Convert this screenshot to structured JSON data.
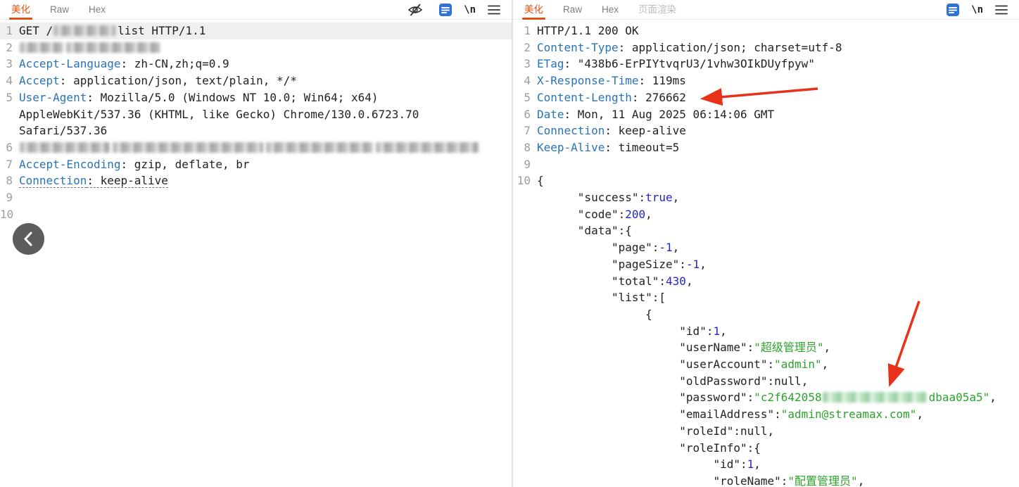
{
  "colors": {
    "accent_tab": "#e05210",
    "header_key": "#2973b7",
    "json_number": "#2525c6",
    "json_string": "#2ca32c",
    "arrow_red": "#e8311a",
    "format_icon_blue": "#2e74d8"
  },
  "left_panel": {
    "tabs": [
      {
        "label": "美化",
        "active": true
      },
      {
        "label": "Raw",
        "active": false
      },
      {
        "label": "Hex",
        "active": false
      }
    ],
    "newline_glyph": "\\n",
    "rows": [
      {
        "num": "1",
        "hl": true,
        "segs": [
          {
            "t": "GET /",
            "c": "p"
          },
          {
            "blur": 88
          },
          {
            "t": "list HTTP/1.1",
            "c": "p"
          }
        ]
      },
      {
        "num": "2",
        "segs": [
          {
            "blur": 62
          },
          {
            "blur": 134
          }
        ]
      },
      {
        "num": "3",
        "segs": [
          {
            "t": "Accept-Language",
            "c": "k"
          },
          {
            "t": ": zh-CN,zh;q=0.9",
            "c": "p"
          }
        ]
      },
      {
        "num": "4",
        "segs": [
          {
            "t": "Accept",
            "c": "k"
          },
          {
            "t": ": application/json, text/plain, */*",
            "c": "p"
          }
        ]
      },
      {
        "num": "5",
        "segs": [
          {
            "t": "User-Agent",
            "c": "k"
          },
          {
            "t": ": Mozilla/5.0 (Windows NT 10.0; Win64; x64)",
            "c": "p"
          }
        ]
      },
      {
        "num": "",
        "segs": [
          {
            "t": "AppleWebKit/537.36 (KHTML, like Gecko) Chrome/130.0.6723.70",
            "c": "p"
          }
        ]
      },
      {
        "num": "",
        "segs": [
          {
            "t": "Safari/537.36",
            "c": "p"
          }
        ]
      },
      {
        "num": "6",
        "segs": [
          {
            "blur": 128
          },
          {
            "blur": 214
          },
          {
            "blur": 152
          },
          {
            "blur": 146
          }
        ]
      },
      {
        "num": "7",
        "segs": [
          {
            "t": "Accept-Encoding",
            "c": "k"
          },
          {
            "t": ": gzip, deflate, br",
            "c": "p"
          }
        ]
      },
      {
        "num": "8",
        "segs": [
          {
            "t": "Connection",
            "c": "k u"
          },
          {
            "t": ": keep-alive",
            "c": "p u"
          }
        ]
      },
      {
        "num": "9",
        "segs": []
      },
      {
        "num": "10",
        "segs": []
      }
    ]
  },
  "right_panel": {
    "tabs": [
      {
        "label": "美化",
        "active": true
      },
      {
        "label": "Raw",
        "active": false
      },
      {
        "label": "Hex",
        "active": false
      },
      {
        "label": "页面渲染",
        "active": false,
        "muted": true
      }
    ],
    "newline_glyph": "\\n",
    "rows": [
      {
        "num": "1",
        "segs": [
          {
            "t": "HTTP/1.1 200 OK",
            "c": "p"
          }
        ]
      },
      {
        "num": "2",
        "segs": [
          {
            "t": "Content-Type",
            "c": "k"
          },
          {
            "t": ": application/json; charset=utf-8",
            "c": "p"
          }
        ]
      },
      {
        "num": "3",
        "segs": [
          {
            "t": "ETag",
            "c": "k"
          },
          {
            "t": ": \"438b6-ErPIYtvqrU3/1vhw3OIkDUyfpyw\"",
            "c": "p"
          }
        ]
      },
      {
        "num": "4",
        "segs": [
          {
            "t": "X-Response-Time",
            "c": "k"
          },
          {
            "t": ": 119ms",
            "c": "p"
          }
        ]
      },
      {
        "num": "5",
        "segs": [
          {
            "t": "Content-Length",
            "c": "k"
          },
          {
            "t": ": 276662",
            "c": "p"
          }
        ]
      },
      {
        "num": "6",
        "segs": [
          {
            "t": "Date",
            "c": "k"
          },
          {
            "t": ": Mon, 11 Aug 2025 06:14:06 GMT",
            "c": "p"
          }
        ]
      },
      {
        "num": "7",
        "segs": [
          {
            "t": "Connection",
            "c": "k"
          },
          {
            "t": ": keep-alive",
            "c": "p"
          }
        ]
      },
      {
        "num": "8",
        "segs": [
          {
            "t": "Keep-Alive",
            "c": "k"
          },
          {
            "t": ": timeout=5",
            "c": "p"
          }
        ]
      },
      {
        "num": "9",
        "segs": []
      },
      {
        "num": "10",
        "segs": [
          {
            "t": "{",
            "c": "p"
          }
        ]
      },
      {
        "num": "",
        "segs": [
          {
            "t": "      \"success\":",
            "c": "p"
          },
          {
            "t": "true",
            "c": "n"
          },
          {
            "t": ",",
            "c": "p"
          }
        ]
      },
      {
        "num": "",
        "segs": [
          {
            "t": "      \"code\":",
            "c": "p"
          },
          {
            "t": "200",
            "c": "n"
          },
          {
            "t": ",",
            "c": "p"
          }
        ]
      },
      {
        "num": "",
        "segs": [
          {
            "t": "      \"data\":{",
            "c": "p"
          }
        ]
      },
      {
        "num": "",
        "segs": [
          {
            "t": "           \"page\":",
            "c": "p"
          },
          {
            "t": "-1",
            "c": "n"
          },
          {
            "t": ",",
            "c": "p"
          }
        ]
      },
      {
        "num": "",
        "segs": [
          {
            "t": "           \"pageSize\":",
            "c": "p"
          },
          {
            "t": "-1",
            "c": "n"
          },
          {
            "t": ",",
            "c": "p"
          }
        ]
      },
      {
        "num": "",
        "segs": [
          {
            "t": "           \"total\":",
            "c": "p"
          },
          {
            "t": "430",
            "c": "n"
          },
          {
            "t": ",",
            "c": "p"
          }
        ]
      },
      {
        "num": "",
        "segs": [
          {
            "t": "           \"list\":[",
            "c": "p"
          }
        ]
      },
      {
        "num": "",
        "segs": [
          {
            "t": "                {",
            "c": "p"
          }
        ]
      },
      {
        "num": "",
        "segs": [
          {
            "t": "                     \"id\":",
            "c": "p"
          },
          {
            "t": "1",
            "c": "n"
          },
          {
            "t": ",",
            "c": "p"
          }
        ]
      },
      {
        "num": "",
        "segs": [
          {
            "t": "                     \"userName\":",
            "c": "p"
          },
          {
            "t": "\"超级管理员\"",
            "c": "s"
          },
          {
            "t": ",",
            "c": "p"
          }
        ]
      },
      {
        "num": "",
        "segs": [
          {
            "t": "                     \"userAccount\":",
            "c": "p"
          },
          {
            "t": "\"admin\"",
            "c": "s"
          },
          {
            "t": ",",
            "c": "p"
          }
        ]
      },
      {
        "num": "",
        "segs": [
          {
            "t": "                     \"oldPassword\":",
            "c": "p"
          },
          {
            "t": "null",
            "c": "a"
          },
          {
            "t": ",",
            "c": "p"
          }
        ]
      },
      {
        "num": "",
        "segs": [
          {
            "t": "                     \"password\":",
            "c": "p"
          },
          {
            "t": "\"c2f642058",
            "c": "s"
          },
          {
            "blur": 148,
            "tint": "g"
          },
          {
            "t": "dbaa05a5\"",
            "c": "s"
          },
          {
            "t": ",",
            "c": "p"
          }
        ]
      },
      {
        "num": "",
        "segs": [
          {
            "t": "                     \"emailAddress\":",
            "c": "p"
          },
          {
            "t": "\"admin@streamax.com\"",
            "c": "s"
          },
          {
            "t": ",",
            "c": "p"
          }
        ]
      },
      {
        "num": "",
        "segs": [
          {
            "t": "                     \"roleId\":",
            "c": "p"
          },
          {
            "t": "null",
            "c": "a"
          },
          {
            "t": ",",
            "c": "p"
          }
        ]
      },
      {
        "num": "",
        "segs": [
          {
            "t": "                     \"roleInfo\":{",
            "c": "p"
          }
        ]
      },
      {
        "num": "",
        "segs": [
          {
            "t": "                          \"id\":",
            "c": "p"
          },
          {
            "t": "1",
            "c": "n"
          },
          {
            "t": ",",
            "c": "p"
          }
        ]
      },
      {
        "num": "",
        "segs": [
          {
            "t": "                          \"roleName\":",
            "c": "p"
          },
          {
            "t": "\"配置管理员\"",
            "c": "s"
          },
          {
            "t": ",",
            "c": "p"
          }
        ]
      }
    ]
  }
}
